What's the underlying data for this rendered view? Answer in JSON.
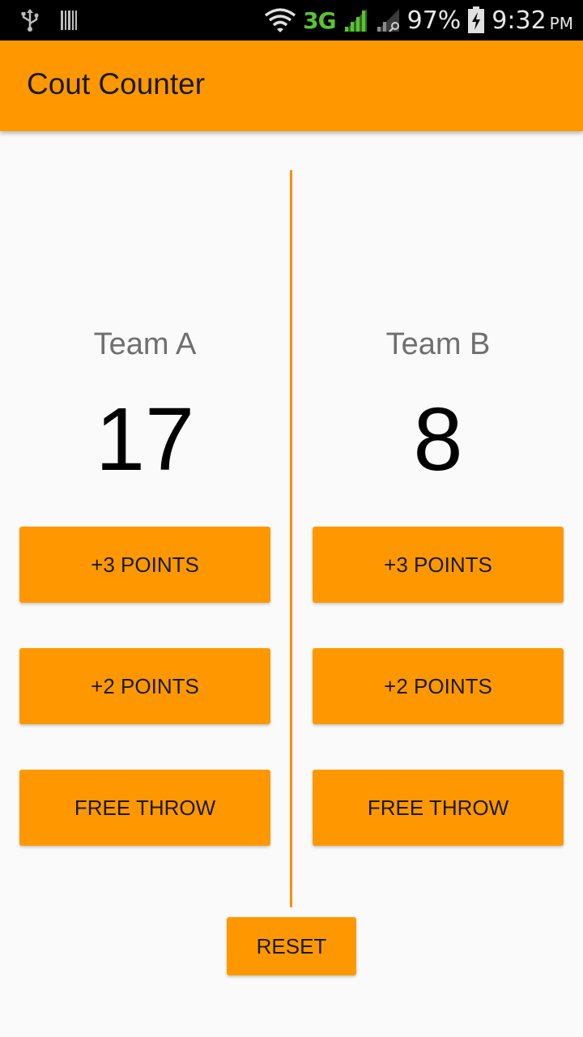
{
  "status_bar": {
    "network": "3G",
    "battery": "97%",
    "time": "9:32",
    "ampm": "PM",
    "icons": [
      "usb-icon",
      "barcode-icon",
      "wifi-icon",
      "signal-icon",
      "signal-no-data-icon",
      "battery-charging-icon"
    ]
  },
  "app_bar": {
    "title": "Cout Counter"
  },
  "team_a": {
    "name": "Team A",
    "score": "17",
    "buttons": {
      "three": "+3 POINTS",
      "two": "+2 POINTS",
      "free": "FREE THROW"
    }
  },
  "team_b": {
    "name": "Team B",
    "score": "8",
    "buttons": {
      "three": "+3 POINTS",
      "two": "+2 POINTS",
      "free": "FREE THROW"
    }
  },
  "reset": {
    "label": "RESET"
  },
  "colors": {
    "accent": "#ff9800",
    "divider": "#ff8c00",
    "background": "#fafafa"
  }
}
